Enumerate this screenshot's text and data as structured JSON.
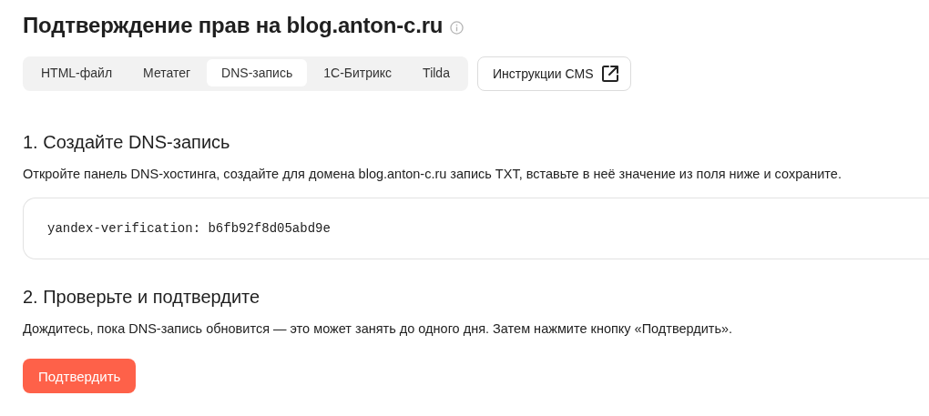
{
  "title": "Подтверждение прав на blog.anton-c.ru",
  "tabs": [
    {
      "label": "HTML-файл",
      "selected": false
    },
    {
      "label": "Метатег",
      "selected": false
    },
    {
      "label": "DNS-запись",
      "selected": true
    },
    {
      "label": "1С-Битрикс",
      "selected": false
    },
    {
      "label": "Tilda",
      "selected": false
    }
  ],
  "cms_button": {
    "label": "Инструкции CMS"
  },
  "steps": [
    {
      "heading": "1. Создайте DNS-запись",
      "text": "Откройте панель DNS-хостинга, создайте для домена blog.anton-c.ru запись TXT, вставьте в неё значение из поля ниже и сохраните.",
      "code": "yandex-verification: b6fb92f8d05abd9e"
    },
    {
      "heading": "2. Проверьте и подтвердите",
      "text": "Дождитесь, пока DNS-запись обновится — это может занять до одного дня. Затем нажмите кнопку «Подтвердить».",
      "button": "Подтвердить"
    }
  ]
}
